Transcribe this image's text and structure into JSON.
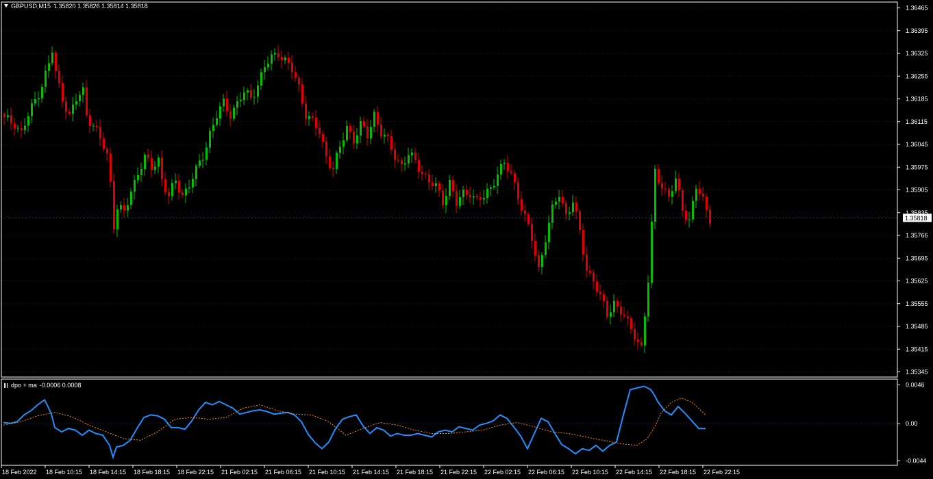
{
  "header": {
    "symbol": "GBPUSD,M15",
    "ohlc": "1.35820 1.35826 1.35814 1.35818"
  },
  "indicator_header": {
    "name": "dpo + ma",
    "values": "-0.0006 0.0008"
  },
  "colors": {
    "background": "#000000",
    "bull": "#00c000",
    "bear": "#e00000",
    "dpo_line": "#1e90ff",
    "ma_line": "#ff8c00",
    "grid": "#1a1a3a",
    "frame": "#ffffff"
  },
  "chart_data": [
    {
      "type": "candlestick",
      "title": "GBPUSD,M15",
      "ylim": [
        1.35345,
        1.36465
      ],
      "y_ticks": [
        "1.36465",
        "1.36395",
        "1.36325",
        "1.36255",
        "1.36185",
        "1.36115",
        "1.36045",
        "1.35975",
        "1.35905",
        "1.35835",
        "1.35766",
        "1.35695",
        "1.35625",
        "1.35555",
        "1.35485",
        "1.35415",
        "1.35345"
      ],
      "current_price": "1.35818",
      "x_ticks": [
        "18 Feb 2022",
        "18 Feb 10:15",
        "18 Feb 14:15",
        "18 Feb 18:15",
        "18 Feb 22:15",
        "21 Feb 02:15",
        "21 Feb 06:15",
        "21 Feb 10:15",
        "21 Feb 14:15",
        "21 Feb 18:15",
        "21 Feb 22:15",
        "22 Feb 02:15",
        "22 Feb 06:15",
        "22 Feb 10:15",
        "22 Feb 14:15",
        "22 Feb 18:15",
        "22 Feb 22:15"
      ],
      "close_path": [
        [
          0,
          1.3612
        ],
        [
          3,
          1.3611
        ],
        [
          5,
          1.3608
        ],
        [
          7,
          1.3613
        ],
        [
          9,
          1.3618
        ],
        [
          11,
          1.3623
        ],
        [
          13,
          1.3629
        ],
        [
          14,
          1.3633
        ],
        [
          15,
          1.3626
        ],
        [
          17,
          1.3619
        ],
        [
          19,
          1.3613
        ],
        [
          21,
          1.3618
        ],
        [
          23,
          1.3621
        ],
        [
          24,
          1.3614
        ],
        [
          26,
          1.361
        ],
        [
          28,
          1.3606
        ],
        [
          30,
          1.3601
        ],
        [
          31,
          1.3593
        ],
        [
          32,
          1.358
        ],
        [
          33,
          1.3585
        ],
        [
          35,
          1.3583
        ],
        [
          37,
          1.359
        ],
        [
          39,
          1.3596
        ],
        [
          41,
          1.36
        ],
        [
          43,
          1.3597
        ],
        [
          45,
          1.36
        ],
        [
          46,
          1.3594
        ],
        [
          48,
          1.3588
        ],
        [
          50,
          1.3593
        ],
        [
          52,
          1.3589
        ],
        [
          54,
          1.3592
        ],
        [
          56,
          1.3596
        ],
        [
          58,
          1.3601
        ],
        [
          60,
          1.3608
        ],
        [
          62,
          1.3613
        ],
        [
          64,
          1.3617
        ],
        [
          66,
          1.3614
        ],
        [
          68,
          1.3617
        ],
        [
          70,
          1.362
        ],
        [
          72,
          1.3619
        ],
        [
          74,
          1.3623
        ],
        [
          76,
          1.3628
        ],
        [
          78,
          1.3631
        ],
        [
          80,
          1.3633
        ],
        [
          82,
          1.363
        ],
        [
          84,
          1.3627
        ],
        [
          86,
          1.3622
        ],
        [
          88,
          1.3614
        ],
        [
          90,
          1.3611
        ],
        [
          92,
          1.3608
        ],
        [
          94,
          1.3601
        ],
        [
          96,
          1.3597
        ],
        [
          98,
          1.3603
        ],
        [
          100,
          1.361
        ],
        [
          102,
          1.3606
        ],
        [
          104,
          1.361
        ],
        [
          106,
          1.3607
        ],
        [
          108,
          1.3614
        ],
        [
          110,
          1.3608
        ],
        [
          112,
          1.3605
        ],
        [
          114,
          1.3601
        ],
        [
          116,
          1.3598
        ],
        [
          118,
          1.3601
        ],
        [
          120,
          1.3599
        ],
        [
          122,
          1.3596
        ],
        [
          124,
          1.3593
        ],
        [
          126,
          1.3591
        ],
        [
          128,
          1.3587
        ],
        [
          130,
          1.3593
        ],
        [
          132,
          1.3586
        ],
        [
          134,
          1.3589
        ],
        [
          136,
          1.359
        ],
        [
          138,
          1.3587
        ],
        [
          140,
          1.3588
        ],
        [
          142,
          1.3591
        ],
        [
          144,
          1.3596
        ],
        [
          146,
          1.3598
        ],
        [
          148,
          1.3595
        ],
        [
          150,
          1.3589
        ],
        [
          152,
          1.3582
        ],
        [
          154,
          1.3575
        ],
        [
          156,
          1.3566
        ],
        [
          158,
          1.3576
        ],
        [
          160,
          1.3584
        ],
        [
          162,
          1.3589
        ],
        [
          164,
          1.3583
        ],
        [
          166,
          1.3587
        ],
        [
          168,
          1.3577
        ],
        [
          170,
          1.3566
        ],
        [
          172,
          1.3563
        ],
        [
          174,
          1.3557
        ],
        [
          176,
          1.3552
        ],
        [
          178,
          1.3556
        ],
        [
          180,
          1.3553
        ],
        [
          182,
          1.3549
        ],
        [
          184,
          1.3546
        ],
        [
          186,
          1.3542
        ],
        [
          188,
          1.3562
        ],
        [
          190,
          1.3596
        ],
        [
          192,
          1.3592
        ],
        [
          194,
          1.3588
        ],
        [
          196,
          1.3593
        ],
        [
          198,
          1.3585
        ],
        [
          200,
          1.3581
        ],
        [
          202,
          1.3591
        ],
        [
          204,
          1.3587
        ],
        [
          206,
          1.3582
        ]
      ]
    },
    {
      "type": "line",
      "title": "dpo + ma",
      "ylim": [
        -0.0044,
        0.0046
      ],
      "y_ticks": [
        "0.0046",
        "0.00",
        "-0.0044"
      ],
      "series": [
        {
          "role": "dpo",
          "x": [
            0,
            2,
            4,
            6,
            8,
            10,
            12,
            13,
            14,
            15,
            17,
            19,
            21,
            23,
            25,
            27,
            29,
            31,
            32,
            33,
            35,
            37,
            39,
            41,
            43,
            45,
            47,
            49,
            51,
            53,
            55,
            57,
            59,
            61,
            63,
            65,
            67,
            69,
            71,
            73,
            75,
            77,
            79,
            81,
            83,
            85,
            87,
            89,
            91,
            93,
            95,
            97,
            99,
            101,
            103,
            105,
            107,
            109,
            111,
            113,
            115,
            117,
            119,
            121,
            123,
            125,
            127,
            129,
            131,
            133,
            135,
            137,
            139,
            141,
            143,
            145,
            147,
            149,
            151,
            153,
            155,
            157,
            159,
            161,
            163,
            165,
            167,
            169,
            171,
            173,
            175,
            177,
            179,
            181,
            183,
            185,
            187,
            188,
            189,
            190,
            191,
            193,
            195,
            197,
            199,
            201,
            203,
            205
          ],
          "values": [
            0.0001,
            0.0,
            0.0002,
            0.001,
            0.0015,
            0.0022,
            0.0028,
            0.002,
            0.0011,
            -0.0005,
            -0.001,
            -0.0006,
            -0.0008,
            -0.0014,
            -0.0008,
            -0.0012,
            -0.0014,
            -0.0026,
            -0.004,
            -0.0028,
            -0.0026,
            -0.002,
            -0.0006,
            0.0007,
            0.001,
            0.0009,
            0.0005,
            -0.0005,
            -0.0005,
            -0.0007,
            0.0003,
            0.0016,
            0.0025,
            0.0022,
            0.0026,
            0.0022,
            0.0018,
            0.0011,
            0.0013,
            0.0015,
            0.0016,
            0.0014,
            0.0011,
            0.0012,
            0.0013,
            0.001,
            0.0002,
            -0.0013,
            -0.0023,
            -0.003,
            -0.0022,
            -0.0006,
            0.0005,
            0.0008,
            0.001,
            -0.0003,
            -0.0012,
            -0.0005,
            -0.0008,
            -0.0015,
            -0.0012,
            -0.0014,
            -0.0014,
            -0.0012,
            -0.0014,
            -0.0016,
            -0.001,
            -0.0008,
            -0.001,
            -0.0004,
            -0.0006,
            -0.0008,
            -0.0002,
            0.0,
            0.0003,
            0.001,
            0.0006,
            -0.0004,
            -0.0015,
            -0.003,
            -0.0012,
            0.0006,
            0.0002,
            -0.0012,
            -0.0025,
            -0.003,
            -0.0036,
            -0.003,
            -0.0032,
            -0.0026,
            -0.0033,
            -0.0026,
            -0.0022,
            0.001,
            0.004,
            0.0042,
            0.0044,
            0.0042,
            0.004,
            0.0034,
            0.0026,
            0.0015,
            0.001,
            0.002,
            0.0012,
            0.0003,
            -0.0006,
            -0.0006
          ]
        },
        {
          "role": "ma",
          "x": [
            0,
            5,
            10,
            15,
            20,
            25,
            30,
            35,
            40,
            45,
            50,
            55,
            60,
            65,
            70,
            75,
            80,
            85,
            90,
            95,
            100,
            105,
            110,
            115,
            120,
            125,
            130,
            135,
            140,
            145,
            150,
            155,
            160,
            165,
            170,
            175,
            180,
            185,
            188,
            190,
            192,
            195,
            198,
            201,
            205
          ],
          "values": [
            -0.0002,
            0.0002,
            0.0009,
            0.0013,
            0.0008,
            -0.0002,
            -0.001,
            -0.0018,
            -0.002,
            -0.001,
            0.0005,
            0.0007,
            0.0005,
            0.0007,
            0.0018,
            0.0022,
            0.0015,
            0.0011,
            0.001,
            0.0002,
            -0.0014,
            -0.0006,
            0.0001,
            -0.0002,
            -0.0008,
            -0.0012,
            -0.0012,
            -0.001,
            -0.0008,
            -0.0002,
            0.0001,
            -0.0004,
            -0.001,
            -0.0012,
            -0.0016,
            -0.002,
            -0.0024,
            -0.0026,
            -0.0018,
            -0.0005,
            0.0012,
            0.0025,
            0.003,
            0.0025,
            0.001
          ]
        }
      ]
    }
  ]
}
